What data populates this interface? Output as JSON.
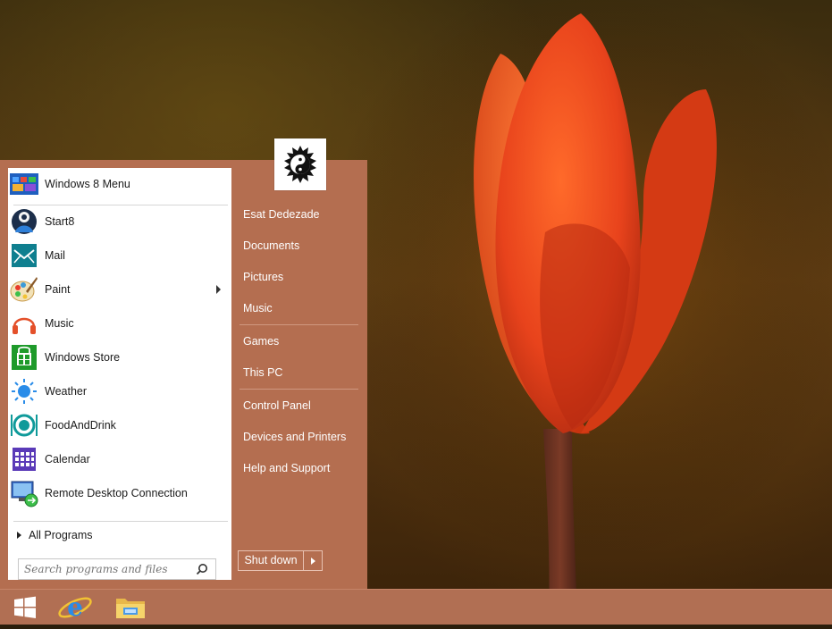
{
  "start_menu": {
    "programs": [
      {
        "label": "Windows 8 Menu",
        "icon": "windows8-menu-icon"
      },
      {
        "label": "Start8",
        "icon": "start8-icon"
      },
      {
        "label": "Mail",
        "icon": "mail-icon"
      },
      {
        "label": "Paint",
        "icon": "paint-icon",
        "has_submenu": true
      },
      {
        "label": "Music",
        "icon": "headphones-icon"
      },
      {
        "label": "Windows Store",
        "icon": "store-icon"
      },
      {
        "label": "Weather",
        "icon": "weather-icon"
      },
      {
        "label": "FoodAndDrink",
        "icon": "food-icon"
      },
      {
        "label": "Calendar",
        "icon": "calendar-icon"
      },
      {
        "label": "Remote Desktop Connection",
        "icon": "remote-desktop-icon"
      }
    ],
    "all_programs": "All Programs",
    "search": {
      "placeholder": "Search programs and files"
    },
    "right_links": [
      "Esat Dedezade",
      "Documents",
      "Pictures",
      "Music",
      "Games",
      "This PC",
      "Control Panel",
      "Devices and Printers",
      "Help and Support"
    ],
    "shutdown_label": "Shut down",
    "accent_color": "#b46e50"
  },
  "taskbar": {
    "items": [
      "start-button-icon",
      "internet-explorer-icon",
      "file-explorer-icon"
    ],
    "color": "#b16f53"
  }
}
